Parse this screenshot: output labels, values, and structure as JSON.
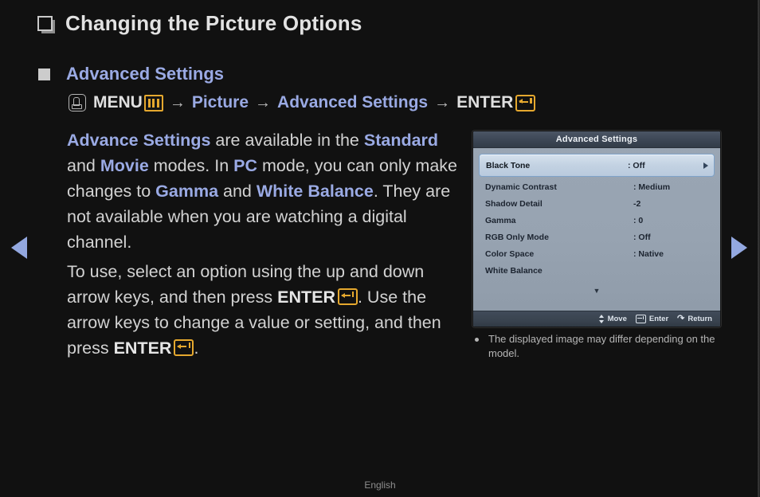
{
  "page": {
    "title": "Changing the Picture Options",
    "section_title": "Advanced Settings",
    "footer_language": "English"
  },
  "nav": {
    "prev_label": "previous-page",
    "next_label": "next-page"
  },
  "menu_path": {
    "remote_icon": "remote-hand-icon",
    "menu_label": "MENU",
    "menu_icon": "menu-bars-icon",
    "arrow1": "→",
    "picture_label": "Picture",
    "arrow2": "→",
    "advanced_label": "Advanced Settings",
    "arrow3": "→",
    "enter_label": "ENTER",
    "enter_icon": "enter-key-icon"
  },
  "paragraph_1": {
    "p1_a": "Advance Settings",
    "p1_b": " are available in the ",
    "p1_c": "Standard",
    "p1_d": " and ",
    "p1_e": "Movie",
    "p1_f": " modes. In ",
    "p1_g": "PC",
    "p1_h": " mode, you can only make changes to ",
    "p1_i": "Gamma",
    "p1_j": " and ",
    "p1_k": "White Balance",
    "p1_l": ". They are not available when you are watching a digital channel."
  },
  "paragraph_2": {
    "p2_a": "To use, select an option using the up and down arrow keys, and then press ",
    "p2_b": "ENTER",
    "p2_c": ". Use the arrow keys to change a value or setting, and then press ",
    "p2_d": "ENTER",
    "p2_e": "."
  },
  "osd": {
    "title": "Advanced Settings",
    "rows": [
      {
        "label": "Black Tone",
        "value": ": Off",
        "selected": true
      },
      {
        "label": "Dynamic Contrast",
        "value": ": Medium",
        "selected": false
      },
      {
        "label": "Shadow Detail",
        "value": "-2",
        "selected": false
      },
      {
        "label": "Gamma",
        "value": ": 0",
        "selected": false
      },
      {
        "label": "RGB Only Mode",
        "value": ": Off",
        "selected": false
      },
      {
        "label": "Color Space",
        "value": ": Native",
        "selected": false
      },
      {
        "label": "White Balance",
        "value": "",
        "selected": false
      }
    ],
    "scroll_down_glyph": "▼",
    "footer": {
      "move_label": "Move",
      "enter_label": "Enter",
      "return_label": "Return",
      "return_glyph": "↶"
    }
  },
  "note": {
    "text": "The displayed image may differ depending on the model."
  },
  "colors": {
    "background": "#111111",
    "accent_blue": "#9aaae4",
    "accent_orange": "#e5a82e",
    "body_text": "#d2d2d2",
    "osd_panel": "#97a3b1",
    "osd_titlebar": "#3b4553"
  }
}
